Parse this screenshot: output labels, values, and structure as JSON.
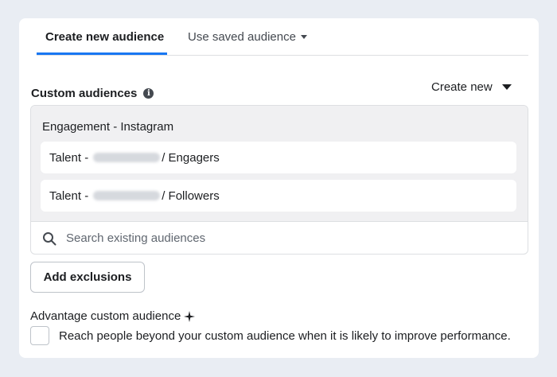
{
  "tabs": {
    "active_label": "Create new audience",
    "saved_label": "Use saved audience"
  },
  "custom_audiences": {
    "title": "Custom audiences",
    "create_new_label": "Create new",
    "group_label": "Engagement - Instagram",
    "items": [
      {
        "prefix": "Talent -",
        "suffix": "/ Engagers"
      },
      {
        "prefix": "Talent -",
        "suffix": "/ Followers"
      }
    ],
    "search_placeholder": "Search existing audiences"
  },
  "exclusions": {
    "button_label": "Add exclusions"
  },
  "advantage": {
    "label": "Advantage custom audience",
    "checkbox_text": "Reach people beyond your custom audience when it is likely to improve performance.",
    "checked": false
  },
  "colors": {
    "accent": "#1877f2",
    "text": "#1c1e21",
    "muted": "#606770",
    "group_bg": "#f0f0f2"
  }
}
